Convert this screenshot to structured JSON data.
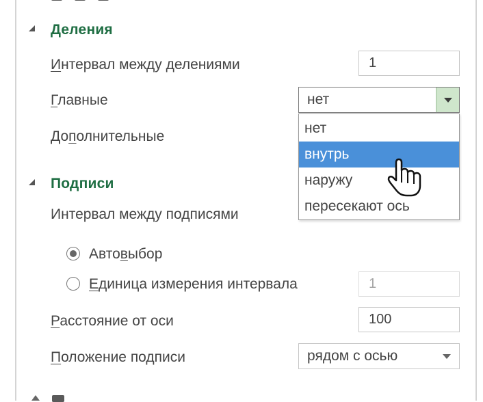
{
  "sections": {
    "tick_marks": {
      "title": "Деления",
      "interval_label": "Интервал между делениями",
      "interval_value": "1",
      "major_label": "Главные",
      "major_value": "нет",
      "minor_label": "Дополнительные",
      "dropdown_options": [
        "нет",
        "внутрь",
        "наружу",
        "пересекают ось"
      ],
      "highlighted_option": "внутрь"
    },
    "labels": {
      "title": "Подписи",
      "interval_label": "Интервал между подписями",
      "radio_auto": "Автовыбор",
      "radio_unit": "Единица измерения интервала",
      "unit_value": "1",
      "distance_label": "Расстояние от оси",
      "distance_value": "100",
      "position_label": "Положение подписи",
      "position_value": "рядом с осью"
    }
  },
  "colors": {
    "section_title": "#1f6e43",
    "highlight": "#4a90d9",
    "combo_button": "#cfe6cc"
  },
  "icons": [
    "collapse-triangle-icon",
    "chevron-down-icon",
    "hand-pointer-icon"
  ]
}
